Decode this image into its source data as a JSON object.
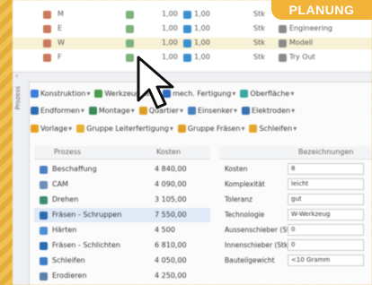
{
  "badge": {
    "label": "PLANUNG",
    "color": "#f2b33a"
  },
  "top_rows": [
    {
      "name": "M",
      "qty": "1,00",
      "val": "1,00",
      "unit": "Stk",
      "desc": "",
      "selected": false
    },
    {
      "name": "E",
      "qty": "1,00",
      "val": "1,00",
      "unit": "Stk",
      "desc": "Engineering",
      "selected": false
    },
    {
      "name": "W",
      "qty": "1,00",
      "val": "1,00",
      "unit": "Stk",
      "desc": "Modell",
      "selected": true
    },
    {
      "name": "F",
      "qty": "1,00",
      "val": "1,00",
      "unit": "Stk",
      "desc": "Try Out",
      "selected": false
    }
  ],
  "side_pane_label": "Prozess",
  "toolbar1": [
    "Konstruktion",
    "Werkzeugbau",
    "mech. Fertigung",
    "Oberfläche"
  ],
  "toolbar2": [
    "Endformen",
    "Montage",
    "Quartier",
    "Einsenker",
    "Elektroden"
  ],
  "toolbar3": [
    "Vorlage",
    "Gruppe Leiterfertigung",
    "Gruppe Fräsen",
    "Schleifen"
  ],
  "grid": {
    "col_process": "Prozess",
    "col_cost": "Kosten",
    "col_props": "Bezeichnungen",
    "rows": [
      {
        "name": "Beschaffung",
        "cost": "4 840,00",
        "color": "#4a7fc1",
        "selected": false
      },
      {
        "name": "CAM",
        "cost": "4 090,00",
        "color": "#6b8fb8",
        "selected": false
      },
      {
        "name": "Drehen",
        "cost": "3 105,00",
        "color": "#3a8f6a",
        "selected": false
      },
      {
        "name": "Fräsen - Schruppen",
        "cost": "7 550,00",
        "color": "#2b6cb0",
        "selected": true
      },
      {
        "name": "Härten",
        "cost": "4 500",
        "color": "#4d8fd6",
        "selected": false
      },
      {
        "name": "Fräsen - Schlichten",
        "cost": "6 810,00",
        "color": "#2b6cb0",
        "selected": false
      },
      {
        "name": "Schleifen",
        "cost": "4 050,00",
        "color": "#3d7cc9",
        "selected": false
      },
      {
        "name": "Erodieren",
        "cost": "4 250,00",
        "color": "#5a7fa8",
        "selected": false
      }
    ],
    "props": [
      {
        "key": "Kosten",
        "value": "8"
      },
      {
        "key": "Komplexität",
        "value": "leicht"
      },
      {
        "key": "Toleranz",
        "value": "gut"
      },
      {
        "key": "Technologie",
        "value": "W-Werkzeug"
      },
      {
        "key": "Aussenschieber (Stk)",
        "value": "0"
      },
      {
        "key": "Innenschieber (Stk)",
        "value": "0"
      },
      {
        "key": "Bauteilgewicht",
        "value": "<10 Gramm"
      }
    ]
  }
}
